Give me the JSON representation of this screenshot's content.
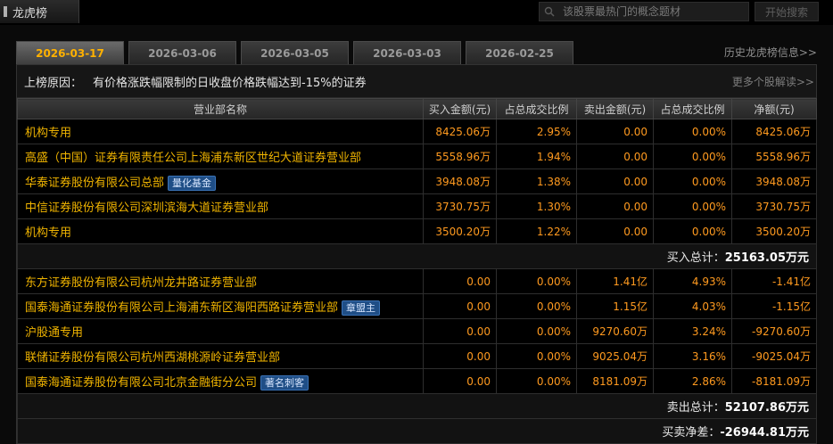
{
  "window": {
    "title": "龙虎榜"
  },
  "search": {
    "placeholder": "该股票最热门的概念题材",
    "button": "开始搜索"
  },
  "tabs": [
    {
      "label": "2026-03-17",
      "active": true
    },
    {
      "label": "2026-03-06",
      "active": false
    },
    {
      "label": "2026-03-05",
      "active": false
    },
    {
      "label": "2026-03-03",
      "active": false
    },
    {
      "label": "2026-02-25",
      "active": false
    }
  ],
  "history_link": "历史龙虎榜信息>>",
  "reason": {
    "label": "上榜原因：",
    "text": "有价格涨跌幅限制的日收盘价格跌幅达到-15%的证券",
    "more": "更多个股解读>>"
  },
  "columns": [
    "营业部名称",
    "买入金额(元)",
    "占总成交比例",
    "卖出金额(元)",
    "占总成交比例",
    "净额(元)"
  ],
  "buy_rows": [
    {
      "name": "机构专用",
      "tag": "",
      "buy": "8425.06万",
      "buy_pct": "2.95%",
      "sell": "0.00",
      "sell_pct": "0.00%",
      "net": "8425.06万"
    },
    {
      "name": "高盛（中国）证券有限责任公司上海浦东新区世纪大道证券营业部",
      "tag": "",
      "buy": "5558.96万",
      "buy_pct": "1.94%",
      "sell": "0.00",
      "sell_pct": "0.00%",
      "net": "5558.96万"
    },
    {
      "name": "华泰证券股份有限公司总部",
      "tag": "量化基金",
      "buy": "3948.08万",
      "buy_pct": "1.38%",
      "sell": "0.00",
      "sell_pct": "0.00%",
      "net": "3948.08万"
    },
    {
      "name": "中信证券股份有限公司深圳滨海大道证券营业部",
      "tag": "",
      "buy": "3730.75万",
      "buy_pct": "1.30%",
      "sell": "0.00",
      "sell_pct": "0.00%",
      "net": "3730.75万"
    },
    {
      "name": "机构专用",
      "tag": "",
      "buy": "3500.20万",
      "buy_pct": "1.22%",
      "sell": "0.00",
      "sell_pct": "0.00%",
      "net": "3500.20万"
    }
  ],
  "buy_total": {
    "label": "买入总计：",
    "value": "25163.05万元"
  },
  "sell_rows": [
    {
      "name": "东方证券股份有限公司杭州龙井路证券营业部",
      "tag": "",
      "buy": "0.00",
      "buy_pct": "0.00%",
      "sell": "1.41亿",
      "sell_pct": "4.93%",
      "net": "-1.41亿"
    },
    {
      "name": "国泰海通证券股份有限公司上海浦东新区海阳西路证券营业部",
      "tag": "章盟主",
      "buy": "0.00",
      "buy_pct": "0.00%",
      "sell": "1.15亿",
      "sell_pct": "4.03%",
      "net": "-1.15亿"
    },
    {
      "name": "沪股通专用",
      "tag": "",
      "buy": "0.00",
      "buy_pct": "0.00%",
      "sell": "9270.60万",
      "sell_pct": "3.24%",
      "net": "-9270.60万"
    },
    {
      "name": "联储证券股份有限公司杭州西湖桃源岭证券营业部",
      "tag": "",
      "buy": "0.00",
      "buy_pct": "0.00%",
      "sell": "9025.04万",
      "sell_pct": "3.16%",
      "net": "-9025.04万"
    },
    {
      "name": "国泰海通证券股份有限公司北京金融街分公司",
      "tag": "著名刺客",
      "buy": "0.00",
      "buy_pct": "0.00%",
      "sell": "8181.09万",
      "sell_pct": "2.86%",
      "net": "-8181.09万"
    }
  ],
  "sell_total": {
    "label": "卖出总计：",
    "value": "52107.86万元"
  },
  "net_total": {
    "label": "买卖净差：",
    "value": "-26944.81万元"
  }
}
